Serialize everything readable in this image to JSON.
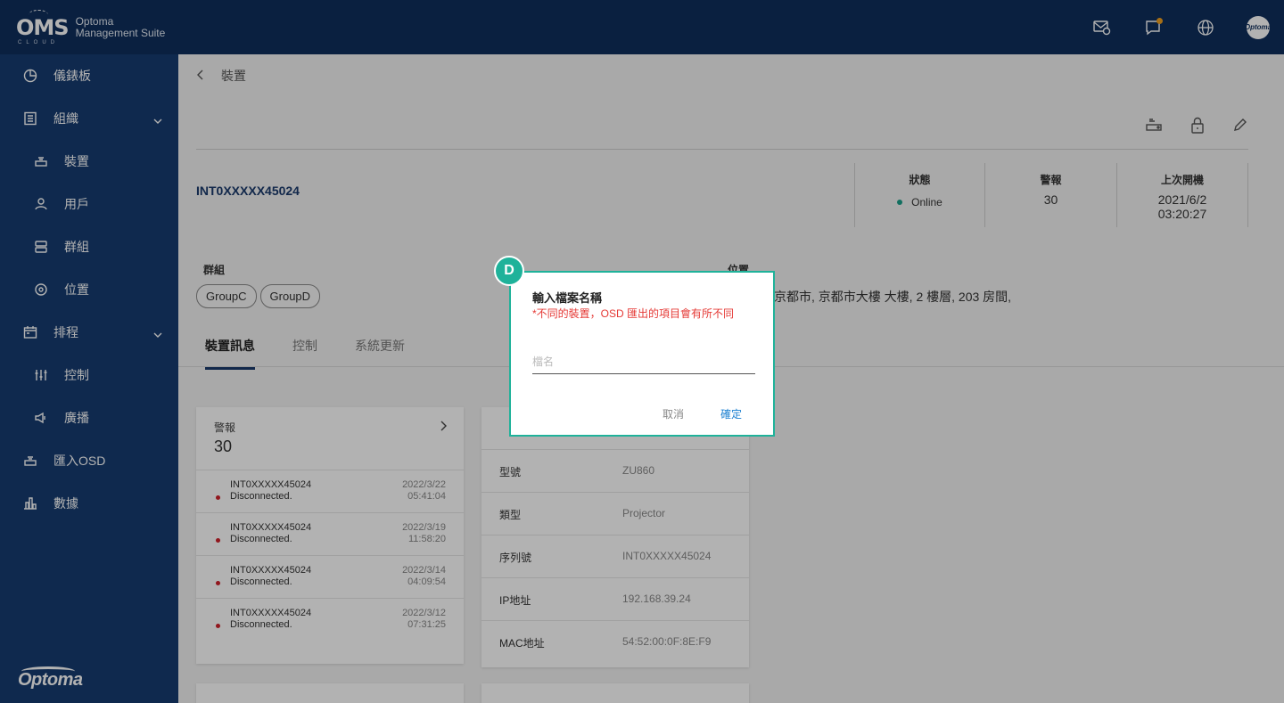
{
  "app": {
    "logo": "OMS",
    "logo_sub": "CLOUD",
    "brand_line1": "Optoma",
    "brand_line2": "Management Suite",
    "avatar_text": "Optoma"
  },
  "sidebar": {
    "items": [
      {
        "label": "儀錶板",
        "icon": "dashboard-icon"
      },
      {
        "label": "組織",
        "icon": "organization-icon"
      },
      {
        "label": "裝置",
        "icon": "device-icon"
      },
      {
        "label": "用戶",
        "icon": "user-icon"
      },
      {
        "label": "群組",
        "icon": "group-icon"
      },
      {
        "label": "位置",
        "icon": "location-icon"
      },
      {
        "label": "排程",
        "icon": "calendar-icon"
      },
      {
        "label": "控制",
        "icon": "control-icon"
      },
      {
        "label": "廣播",
        "icon": "broadcast-icon"
      },
      {
        "label": "匯入OSD",
        "icon": "import-icon"
      },
      {
        "label": "數據",
        "icon": "stats-icon"
      }
    ],
    "footer_brand": "Optoma"
  },
  "main": {
    "breadcrumb": "裝置",
    "device_name": "INT0XXXXX45024",
    "stats": {
      "status_label": "狀態",
      "status_value": "Online",
      "alert_label": "警報",
      "alert_value": "30",
      "last_on_label": "上次開機",
      "last_on_date": "2021/6/2",
      "last_on_time": "03:20:27"
    },
    "group_label": "群組",
    "groups": [
      "GroupC",
      "GroupD"
    ],
    "location_label": "位置",
    "location_value": "京都市, 京都市大樓 大樓, 2 樓層, 203 房間,",
    "tabs": [
      "裝置訊息",
      "控制",
      "系統更新"
    ],
    "alert_card": {
      "title": "警報",
      "count": "30",
      "rows": [
        {
          "name": "INT0XXXXX45024",
          "msg": "Disconnected.",
          "date": "2022/3/22",
          "time": "05:41:04"
        },
        {
          "name": "INT0XXXXX45024",
          "msg": "Disconnected.",
          "date": "2022/3/19",
          "time": "11:58:20"
        },
        {
          "name": "INT0XXXXX45024",
          "msg": "Disconnected.",
          "date": "2022/3/14",
          "time": "04:09:54"
        },
        {
          "name": "INT0XXXXX45024",
          "msg": "Disconnected.",
          "date": "2022/3/12",
          "time": "07:31:25"
        }
      ]
    },
    "info_card": {
      "rows": [
        {
          "key": "型號",
          "value": "ZU860"
        },
        {
          "key": "類型",
          "value": "Projector"
        },
        {
          "key": "序列號",
          "value": "INT0XXXXX45024"
        },
        {
          "key": "IP地址",
          "value": "192.168.39.24"
        },
        {
          "key": "MAC地址",
          "value": "54:52:00:0F:8E:F9"
        }
      ]
    }
  },
  "dialog": {
    "badge": "D",
    "title": "輸入檔案名稱",
    "warning": "*不同的裝置，OSD 匯出的項目會有所不同",
    "input_placeholder": "檔名",
    "cancel_label": "取消",
    "ok_label": "確定"
  },
  "colors": {
    "topbar": "#0f2e5c",
    "sidebar": "#163c70",
    "accent": "#1fb29a",
    "warning": "#e53935",
    "link": "#1a7fd0"
  }
}
